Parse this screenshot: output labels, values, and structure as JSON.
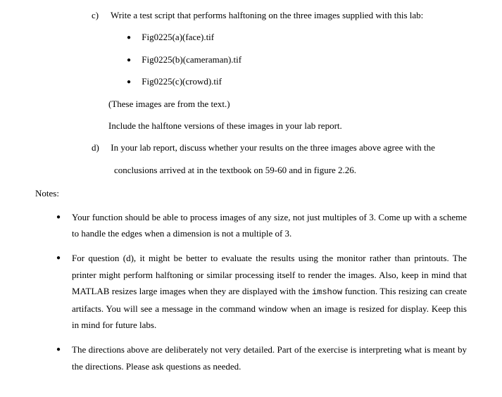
{
  "item_c": {
    "letter": "c)",
    "text": "Write a test script that performs halftoning on the three images supplied with this lab:",
    "files": [
      "Fig0225(a)(face).tif",
      "Fig0225(b)(cameraman).tif",
      "Fig0225(c)(crowd).tif"
    ],
    "source_note": "(These images are from the text.)",
    "include_note": "Include the halftone versions of these images in your lab report."
  },
  "item_d": {
    "letter": "d)",
    "text_line1": "In your lab report, discuss whether your results on the three images above agree with the",
    "text_line2": "conclusions arrived at in the textbook on 59-60 and in figure 2.26."
  },
  "notes_heading": "Notes:",
  "notes": [
    "Your function should be able to process images of any size, not just multiples of 3.  Come up with a scheme to handle the edges when a dimension is not a multiple of 3.",
    "For question (d), it might be better to evaluate the results using the monitor rather than printouts.  The printer might perform halftoning or similar processing itself to render the images.  Also, keep in mind that MATLAB resizes large images when they are displayed with the imshow function.  This resizing can create artifacts.  You will see a message in the command window when an image is resized for display.  Keep this in mind for future labs.",
    "The directions above are deliberately not very detailed.  Part of the exercise is interpreting what is meant by the directions.  Please ask questions as needed."
  ]
}
